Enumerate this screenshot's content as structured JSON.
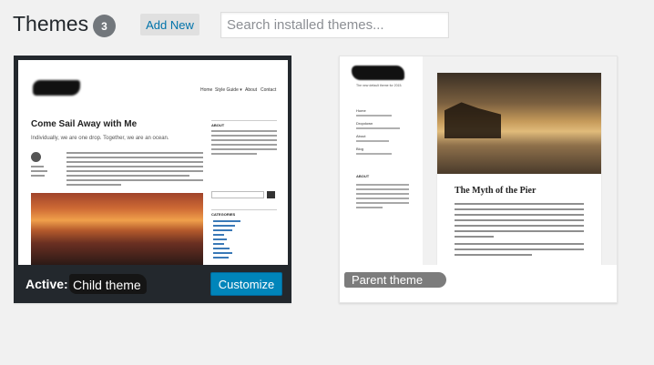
{
  "header": {
    "title": "Themes",
    "count": "3",
    "add_new": "Add New",
    "search_placeholder": "Search installed themes..."
  },
  "themes": [
    {
      "status_label": "Active:",
      "name": "Child theme",
      "action_label": "Customize",
      "preview": {
        "nav": [
          "Home",
          "Style Guide ▾",
          "About",
          "Contact"
        ],
        "post_title": "Come Sail Away with Me",
        "post_subtitle": "Individually, we are one drop. Together, we are an ocean.",
        "sidebar_about": "ABOUT",
        "sidebar_categories": "CATEGORIES"
      }
    },
    {
      "name": "Parent theme",
      "preview": {
        "description": "The new default theme for 2015.",
        "menu_home": "Home",
        "menu_dropdown": "Dropdown",
        "menu_about": "About",
        "menu_blog": "Blog",
        "sidebar_about": "ABOUT",
        "post_title": "The Myth of the Pier"
      }
    }
  ]
}
